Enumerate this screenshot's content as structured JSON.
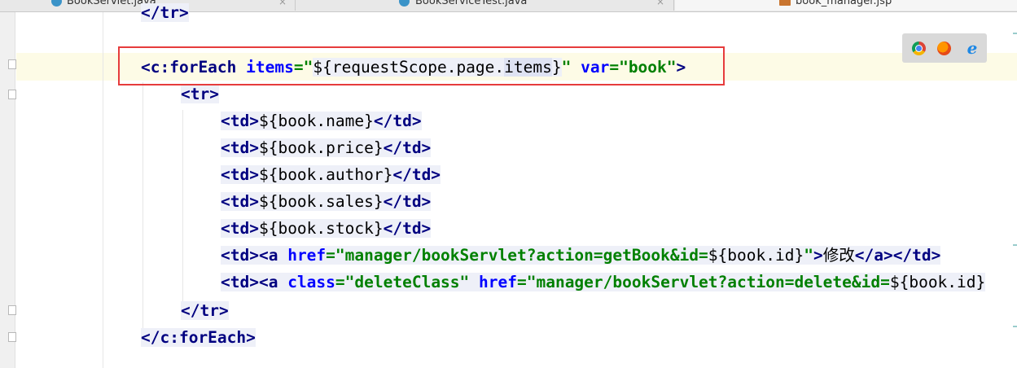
{
  "tabs": [
    {
      "label": "BookServlet.java",
      "close": "×"
    },
    {
      "label": "BookServiceTest.java",
      "close": "×"
    },
    {
      "label": "book_manager.jsp"
    }
  ],
  "browser_icons": [
    "chrome-icon",
    "firefox-icon",
    "ie-icon"
  ],
  "ie_glyph": "e",
  "code": {
    "l0": {
      "close_tr": "</tr>"
    },
    "l1": {
      "open": "<c:forEach ",
      "items_attr": "items",
      "eq1": "=",
      "q1": "\"",
      "el_pre": "${requestScope.page.",
      "el_hl": "items",
      "el_post": "}",
      "q2": "\"",
      "var_attr": " var",
      "eq2": "=",
      "var_val": "\"book\"",
      "close": ">"
    },
    "l2": {
      "tag": "<tr>"
    },
    "rows": [
      {
        "open": "<td>",
        "el": "${book.name}",
        "close": "</td>"
      },
      {
        "open": "<td>",
        "el": "${book.price}",
        "close": "</td>"
      },
      {
        "open": "<td>",
        "el": "${book.author}",
        "close": "</td>"
      },
      {
        "open": "<td>",
        "el": "${book.sales}",
        "close": "</td>"
      },
      {
        "open": "<td>",
        "el": "${book.stock}",
        "close": "</td>"
      }
    ],
    "l8": {
      "td": "<td>",
      "a": "<a ",
      "href_attr": "href",
      "eq": "=",
      "href_val_pre": "\"manager/bookServlet?action=getBook&id=",
      "el": "${book.id}",
      "q": "\"",
      "gt": ">",
      "text": "修改",
      "a_close": "</a>",
      "td_close": "</td>"
    },
    "l9": {
      "td": "<td>",
      "a": "<a ",
      "class_attr": "class",
      "eq1": "=",
      "class_val": "\"deleteClass\"",
      "href_attr": " href",
      "eq2": "=",
      "href_val_pre": "\"manager/bookServlet?action=delete&id=",
      "el": "${book.id}"
    },
    "l10": {
      "tag": "</tr>"
    },
    "l11": {
      "tag": "</c:forEach>"
    }
  }
}
